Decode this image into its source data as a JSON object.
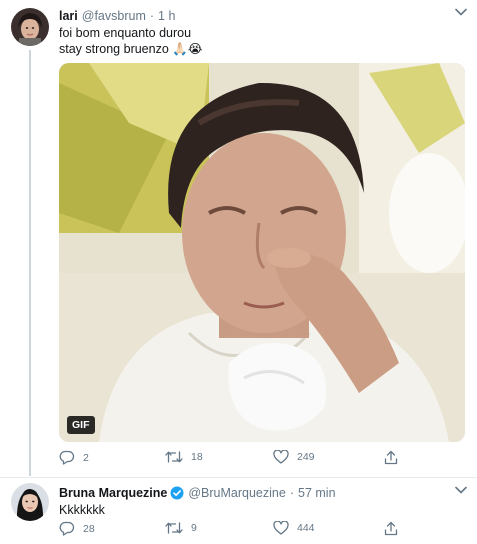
{
  "tweets": [
    {
      "name": "lari",
      "handle": "@favsbrum",
      "separator": "·",
      "time": "1 h",
      "text_lines": [
        "foi bom enquanto durou",
        "stay strong bruenzo 🙏🏻😭"
      ],
      "media_badge": "GIF",
      "reply_count": "2",
      "retweet_count": "18",
      "like_count": "249"
    },
    {
      "name": "Bruna Marquezine",
      "verified": true,
      "handle": "@BruMarquezine",
      "separator": "·",
      "time": "57 min",
      "text": "Kkkkkkk",
      "reply_count": "28",
      "retweet_count": "9",
      "like_count": "444"
    }
  ],
  "colors": {
    "text": "#14171a",
    "secondary": "#657786",
    "verified": "#1da1f2",
    "thread_line": "#ccd6dd"
  },
  "icons": [
    "reply-icon",
    "retweet-icon",
    "like-icon",
    "share-icon",
    "chevron-down-icon",
    "verified-badge-icon"
  ]
}
